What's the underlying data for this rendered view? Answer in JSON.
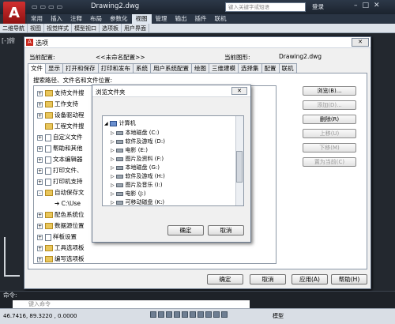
{
  "app": {
    "doc_title": "Drawing2.dwg",
    "search_placeholder": "键入关键字或短语",
    "login": "登录",
    "menus": [
      "常用",
      "插入",
      "注释",
      "布局",
      "参数化",
      "视图",
      "管理",
      "输出",
      "插件",
      "联机"
    ],
    "active_menu": "视图",
    "strip_tabs": [
      "二维导航",
      "视图",
      "视觉样式",
      "模型视口",
      "选项板",
      "用户界面"
    ],
    "ucs_label": "[-]俯"
  },
  "options_dialog": {
    "title": "选项",
    "current_profile_label": "当前配置:",
    "current_profile_value": "<<未命名配置>>",
    "current_drawing_label": "当前图形:",
    "current_drawing_value": "Drawing2.dwg",
    "tabs": [
      "文件",
      "显示",
      "打开和保存",
      "打印和发布",
      "系统",
      "用户系统配置",
      "绘图",
      "三维建模",
      "选择集",
      "配置",
      "联机"
    ],
    "active_tab": "文件",
    "path_label": "搜索路径、文件名和文件位置:",
    "tree_items": [
      {
        "exp": "+",
        "icon": "folder",
        "label": "支持文件搜"
      },
      {
        "exp": "+",
        "icon": "folder",
        "label": "工作支持"
      },
      {
        "exp": "+",
        "icon": "folder",
        "label": "设备驱动程"
      },
      {
        "exp": "",
        "icon": "folder",
        "label": "工程文件搜"
      },
      {
        "exp": "+",
        "icon": "doc",
        "label": "自定义文件"
      },
      {
        "exp": "+",
        "icon": "doc",
        "label": "帮助和其他"
      },
      {
        "exp": "+",
        "icon": "doc",
        "label": "文本编辑器"
      },
      {
        "exp": "+",
        "icon": "doc",
        "label": "打印文件、"
      },
      {
        "exp": "+",
        "icon": "doc",
        "label": "打印机支持"
      },
      {
        "exp": "-",
        "icon": "folder",
        "label": "自动保存文"
      },
      {
        "exp": "",
        "icon": "arrow",
        "label": "C:\\Use"
      },
      {
        "exp": "+",
        "icon": "folder",
        "label": "配色系统位"
      },
      {
        "exp": "+",
        "icon": "folder",
        "label": "数据源位置"
      },
      {
        "exp": "+",
        "icon": "doc",
        "label": "样板设置"
      },
      {
        "exp": "+",
        "icon": "folder",
        "label": "工具选项板"
      },
      {
        "exp": "+",
        "icon": "folder",
        "label": "编写选项板"
      }
    ],
    "side_buttons": [
      {
        "label": "浏览(B)...",
        "enabled": true
      },
      {
        "label": "添加(D)...",
        "enabled": false
      },
      {
        "label": "删除(R)",
        "enabled": true
      },
      {
        "label": "上移(U)",
        "enabled": false
      },
      {
        "label": "下移(M)",
        "enabled": false
      },
      {
        "label": "置为当前(C)",
        "enabled": false
      }
    ],
    "ok_label": "确定",
    "cancel_label": "取消",
    "apply_label": "应用(A)",
    "help_label": "帮助(H)"
  },
  "browse_dialog": {
    "title": "浏览文件夹",
    "root_label": "计算机",
    "drives": [
      "本地磁盘 (C:)",
      "软件及游戏 (D:)",
      "电影 (E:)",
      "图片及资料 (F:)",
      "本地磁盘 (G:)",
      "软件及游戏 (H:)",
      "图片及音乐 (I:)",
      "电影 (J:)",
      "可移动磁盘 (K:)"
    ],
    "ok_label": "确定",
    "cancel_label": "取消"
  },
  "command": {
    "label": "命令:",
    "placeholder": "键入命令"
  },
  "status": {
    "coords": "46.7416, 89.3220 , 0.0000",
    "model": "模型"
  }
}
